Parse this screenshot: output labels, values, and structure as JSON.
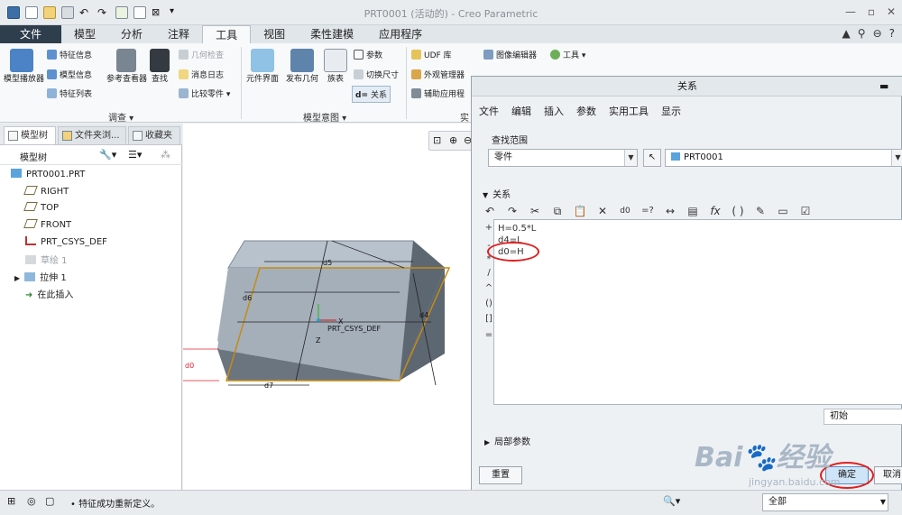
{
  "window": {
    "title": "PRT0001 (活动的) - Creo Parametric"
  },
  "tabs": [
    "文件",
    "模型",
    "分析",
    "注释",
    "工具",
    "视图",
    "柔性建模",
    "应用程序"
  ],
  "active_tab": "工具",
  "ribbon": {
    "model_player": "模型播放器",
    "feature_info": "特征信息",
    "model_info": "模型信息",
    "feature_list": "特征列表",
    "ref_viewer": "参考查看器",
    "find": "查找",
    "geom_check": "几何检查",
    "msg_log": "消息日志",
    "compare_parts": "比较零件",
    "group_investigate": "调查",
    "component_interface": "元件界面",
    "publish_geometry": "发布几何",
    "family_table": "族表",
    "parameters": "参数",
    "switch_dims": "切换尺寸",
    "relations": "关系",
    "group_model_intent": "模型意图",
    "udf_library": "UDF 库",
    "appearance_mgr": "外观管理器",
    "aux_app": "辅助应用程",
    "utilities_short": "实",
    "image_editor": "图像编辑器",
    "tools_menu": "工具"
  },
  "left_panel": {
    "tabs": [
      "模型树",
      "文件夹浏...",
      "收藏夹"
    ],
    "tree_header": "模型树",
    "tree": [
      {
        "label": "PRT0001.PRT",
        "dim": false
      },
      {
        "label": "RIGHT",
        "dim": false
      },
      {
        "label": "TOP",
        "dim": false
      },
      {
        "label": "FRONT",
        "dim": false
      },
      {
        "label": "PRT_CSYS_DEF",
        "dim": false
      },
      {
        "label": "草绘 1",
        "dim": true
      },
      {
        "label": "拉伸 1",
        "dim": false
      },
      {
        "label": "在此插入",
        "dim": false
      }
    ]
  },
  "viewport": {
    "dims": {
      "d5": "d5",
      "d6": "d6",
      "d4": "d4",
      "d7": "d7",
      "d0": "d0"
    },
    "csys_label": "PRT_CSYS_DEF",
    "axis_x": "X",
    "axis_z": "Z"
  },
  "dialog": {
    "title": "关系",
    "menu": [
      "文件",
      "编辑",
      "插入",
      "参数",
      "实用工具",
      "显示"
    ],
    "search_scope_label": "查找范围",
    "scope_type": "零件",
    "scope_object": "PRT0001",
    "relations_label": "关系",
    "relations": [
      "H=0.5*L",
      "d4=L",
      "d0=H"
    ],
    "operators": [
      "+",
      "-",
      "*",
      "/",
      "^",
      "()",
      "[]",
      "="
    ],
    "initial_label": "初始",
    "local_params_label": "局部参数",
    "reset_button": "重置",
    "ok_button": "确定",
    "cancel_button": "取消"
  },
  "status": {
    "message": "• 特征成功重新定义。",
    "filter": "全部"
  },
  "watermark": {
    "brand": "Bai",
    "brand2": "经验",
    "url": "jingyan.baidu.com"
  }
}
